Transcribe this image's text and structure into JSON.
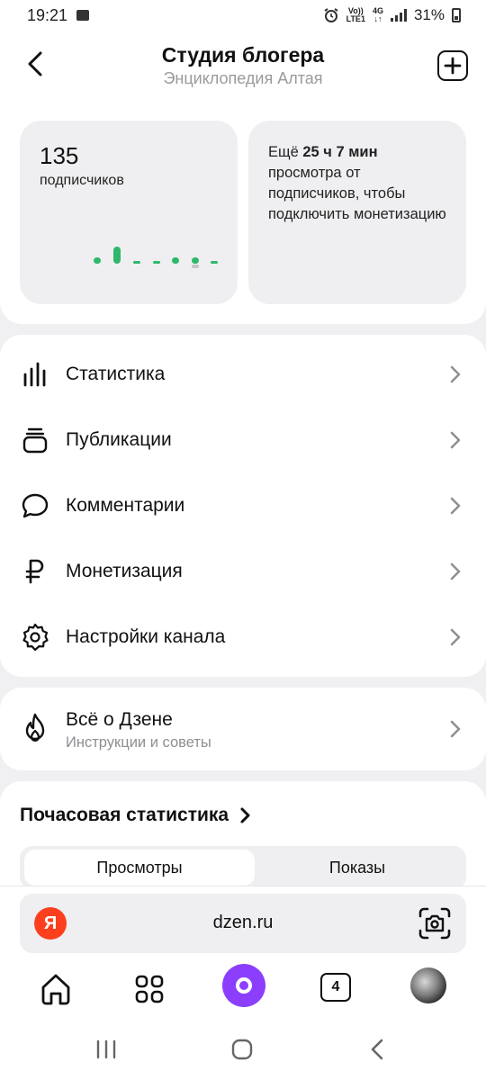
{
  "status": {
    "time": "19:21",
    "volte": "Vo))",
    "lte": "LTE1",
    "net": "4G",
    "battery": "31%"
  },
  "header": {
    "title": "Студия блогера",
    "subtitle": "Энциклопедия Алтая"
  },
  "stats": {
    "subscribers_count": "135",
    "subscribers_label": "подписчиков",
    "monetization_prefix": "Ещё",
    "monetization_time": "25 ч 7 мин",
    "monetization_text": "просмотра от подписчиков, чтобы подключить монетизацию"
  },
  "menu": {
    "items": [
      {
        "label": "Статистика",
        "icon": "bar-chart-icon"
      },
      {
        "label": "Публикации",
        "icon": "stack-icon"
      },
      {
        "label": "Комментарии",
        "icon": "chat-bubble-icon"
      },
      {
        "label": "Монетизация",
        "icon": "ruble-icon"
      },
      {
        "label": "Настройки канала",
        "icon": "gear-icon"
      }
    ]
  },
  "about": {
    "title": "Всё о Дзене",
    "subtitle": "Инструкции и советы",
    "icon": "flame-icon"
  },
  "hourly": {
    "title": "Почасовая статистика",
    "tab_views": "Просмотры",
    "tab_impressions": "Показы",
    "active_tab": "Просмотры"
  },
  "browser": {
    "logo": "Я",
    "url": "dzen.ru",
    "tabs_count": "4"
  },
  "colors": {
    "accent_green": "#2fb86b",
    "alice_purple": "#8b3ffc",
    "yandex_red": "#fc3f1d"
  }
}
